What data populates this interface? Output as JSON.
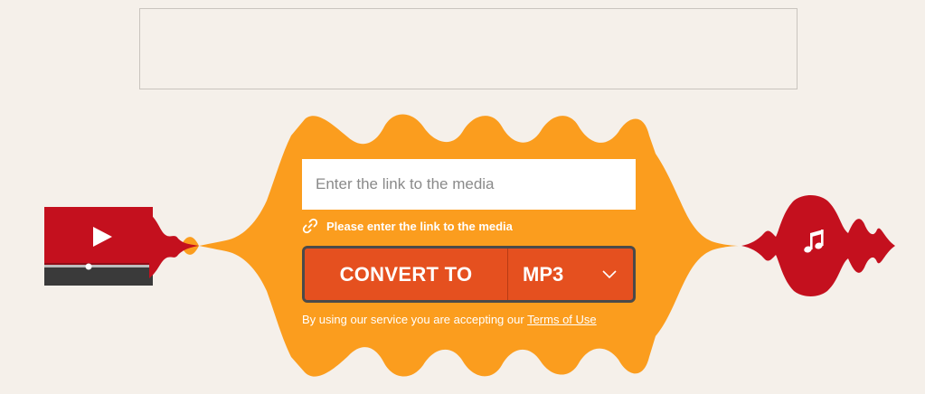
{
  "colors": {
    "background": "#f5f0ea",
    "wave": "#fb9d1e",
    "accent_orange": "#e5501f",
    "red": "#c4101e",
    "dark_border": "#4a4a4a"
  },
  "form": {
    "input_placeholder": "Enter the link to the media",
    "input_value": "",
    "hint_text": "Please enter the link to the media",
    "hint_icon": "link-icon",
    "convert_label": "CONVERT TO",
    "format_selected": "MP3",
    "format_icon": "chevron-down-icon",
    "terms_prefix": "By using our service you are accepting our ",
    "terms_link": "Terms of Use"
  },
  "decor": {
    "left_icon": "video-player-icon",
    "right_icon": "music-note-icon"
  }
}
